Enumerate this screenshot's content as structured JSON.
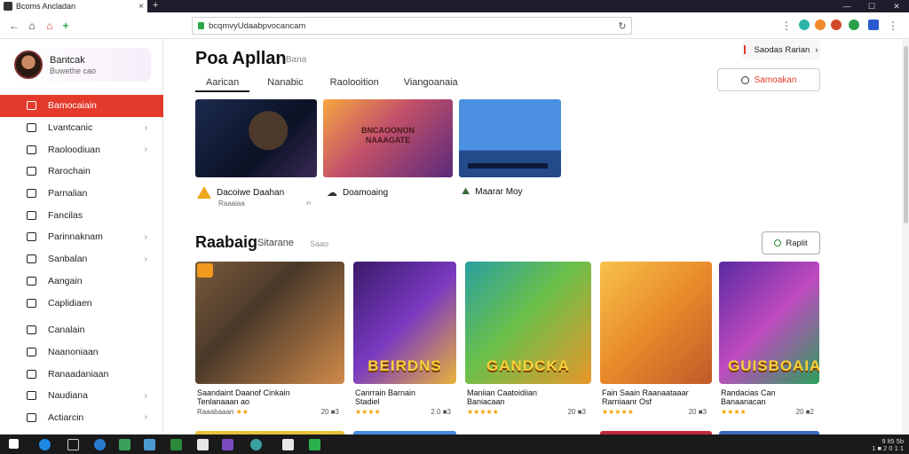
{
  "browser": {
    "tab_title": "Bcoms Ancladan",
    "tab_close": "×",
    "new_tab": "+",
    "url": "bcqmvyUdaabpvocancam",
    "win_min": "—",
    "win_max": "☐",
    "win_close": "✕"
  },
  "profile": {
    "name": "Bantcak",
    "subtitle": "Buwethe cao"
  },
  "sidebar": {
    "items": [
      {
        "label": "Bamocaiain",
        "active": true,
        "chevron": false
      },
      {
        "label": "Lvantcanic",
        "chevron": true
      },
      {
        "label": "Raoloodiuan",
        "chevron": true
      },
      {
        "label": "Rarochain",
        "chevron": false
      },
      {
        "label": "Parnalian",
        "chevron": false
      },
      {
        "label": "Fancilas",
        "chevron": false
      },
      {
        "label": "Parinnaknam",
        "chevron": true
      },
      {
        "label": "Sanbalan",
        "chevron": true
      },
      {
        "label": "Aangain",
        "chevron": false
      },
      {
        "label": "Caplidiaen",
        "chevron": false
      },
      {
        "label": "Canalain",
        "chevron": false
      },
      {
        "label": "Naanoniaan",
        "chevron": false
      },
      {
        "label": "Ranaadaniaan",
        "chevron": false
      },
      {
        "label": "Naudiana",
        "chevron": true
      },
      {
        "label": "Actiarcin",
        "chevron": true
      }
    ]
  },
  "header": {
    "title": "Poa Apllan",
    "subtitle": "Bana",
    "tabs": [
      "Aarican",
      "Nanabic",
      "Raolooition",
      "Viangoanaia"
    ],
    "top_button": "Saodas Rarian",
    "top_button_chevron": "›",
    "search_button": "Samoakan"
  },
  "featured": [
    {
      "caption": "Dacoiwe Daahan",
      "sub": "Raaaiaa",
      "icon": "warning-icon"
    },
    {
      "caption": "Doamoaing",
      "icon": "cloud-icon",
      "art_text": "BNCAOONON NAAAGATE"
    },
    {
      "caption": "Maarar Moy",
      "icon": "mountain-icon"
    }
  ],
  "featured_sub_icon": "‹›",
  "section": {
    "title": "Raabaig",
    "subtitle": "Sitarane",
    "subtitle2": "Saao",
    "button": "Raplit"
  },
  "games": [
    {
      "title": "Saandaint Daanof Cinkain",
      "sub": "Tenlanaaan ao",
      "rating": "Raaabaaan",
      "stars": "★★",
      "price": "20 ■3"
    },
    {
      "title": "Canrrain Barnain",
      "sub": "Stadiel",
      "rating": "",
      "stars": "★★★★",
      "price": "2.0 ■3",
      "banner": "BEIRDNS"
    },
    {
      "title": "Maniian Caatoidiian",
      "sub": "Baniacaan",
      "rating": "",
      "stars": "★★★★★",
      "price": "20 ■3",
      "banner": "GANDCKA"
    },
    {
      "title": "Fain Saain Raanaataaar",
      "sub": "Rarniaanr Osf",
      "rating": "",
      "stars": "★★★★★",
      "price": "20 ■3"
    },
    {
      "title": "Randacias Can",
      "sub": "Banaanacan",
      "rating": "",
      "stars": "★★★★",
      "price": "20 ■2",
      "banner": "GUISBOAIA"
    }
  ],
  "tray": {
    "time": "9 lt5 5b",
    "date": "1 ■ 2 0 1 1"
  },
  "colors": {
    "accent": "#e33a2c",
    "star": "#f2a100"
  }
}
